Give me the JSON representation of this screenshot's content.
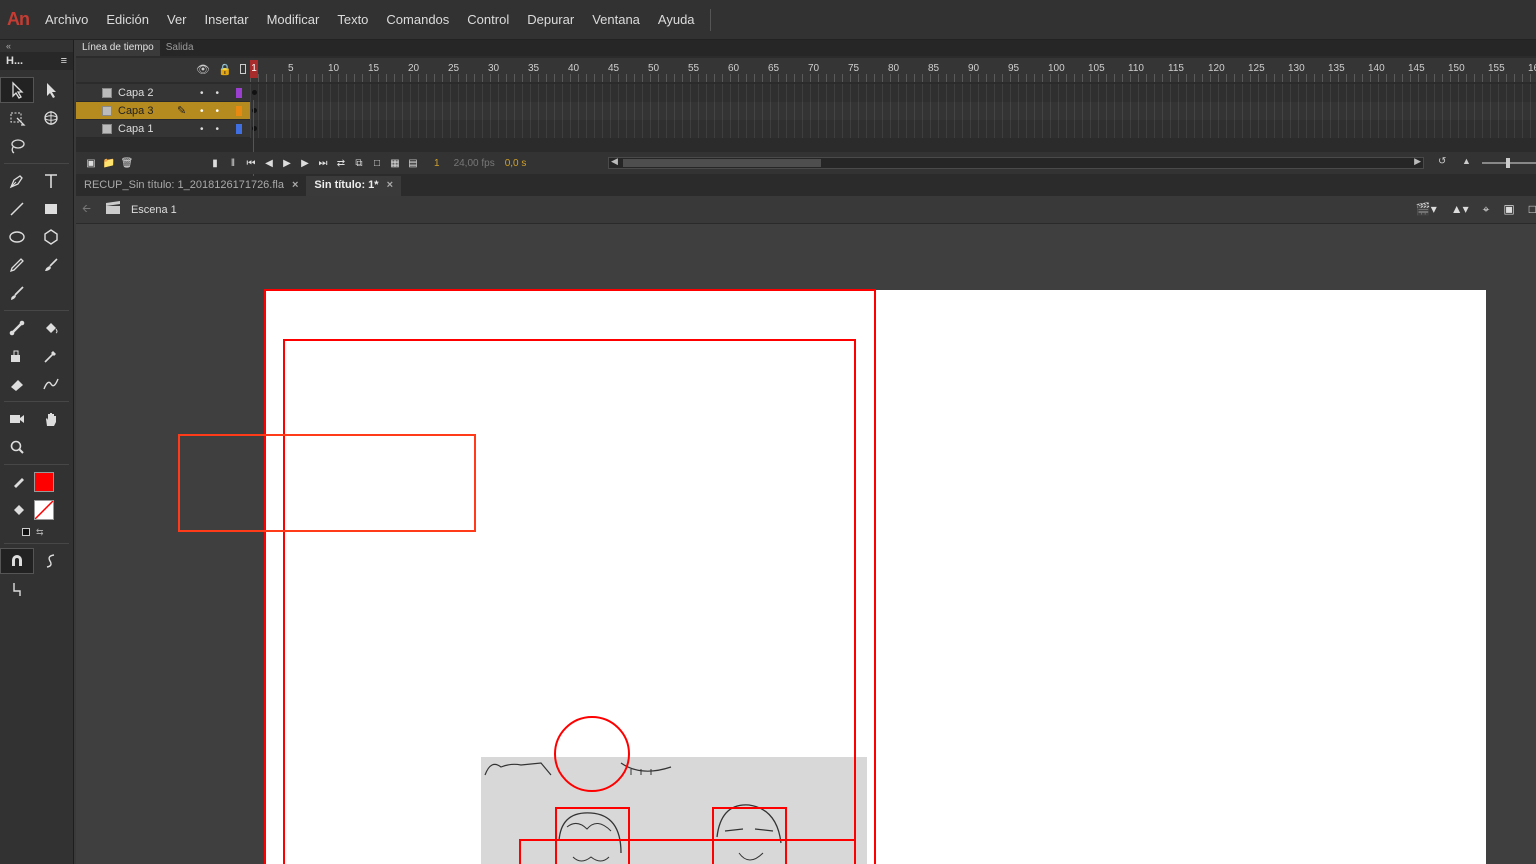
{
  "app": {
    "logo": "An"
  },
  "menu": [
    "Archivo",
    "Edición",
    "Ver",
    "Insertar",
    "Modificar",
    "Texto",
    "Comandos",
    "Control",
    "Depurar",
    "Ventana",
    "Ayuda"
  ],
  "tools_panel": {
    "collapse": "«",
    "title": "H...",
    "menu_icon": "≡"
  },
  "timeline": {
    "tabs": [
      "Línea de tiempo",
      "Salida"
    ],
    "ruler": [
      "1",
      "5",
      "10",
      "15",
      "20",
      "25",
      "30",
      "35",
      "40",
      "45",
      "50",
      "55",
      "60",
      "65",
      "70",
      "75",
      "80",
      "85",
      "90",
      "95",
      "100",
      "105",
      "110",
      "115",
      "120",
      "125",
      "130",
      "135",
      "140",
      "145",
      "150",
      "155",
      "16"
    ],
    "layers": [
      {
        "name": "Capa 2",
        "color": "#9b3fd0",
        "selected": false
      },
      {
        "name": "Capa 3",
        "color": "#e88a12",
        "selected": true
      },
      {
        "name": "Capa 1",
        "color": "#3f6fe0",
        "selected": false
      }
    ],
    "current_frame": "1",
    "fps": "24,00 fps",
    "seconds": "0,0 s"
  },
  "doc_tabs": [
    {
      "label": "RECUP_Sin título: 1_2018126171726.fla",
      "active": false
    },
    {
      "label": "Sin título: 1*",
      "active": true
    }
  ],
  "scene": {
    "label": "Escena 1"
  },
  "colors": {
    "stroke": "#ff0000",
    "fill": "none",
    "accent": "#c43c33",
    "selected_layer": "#b58a1f"
  }
}
